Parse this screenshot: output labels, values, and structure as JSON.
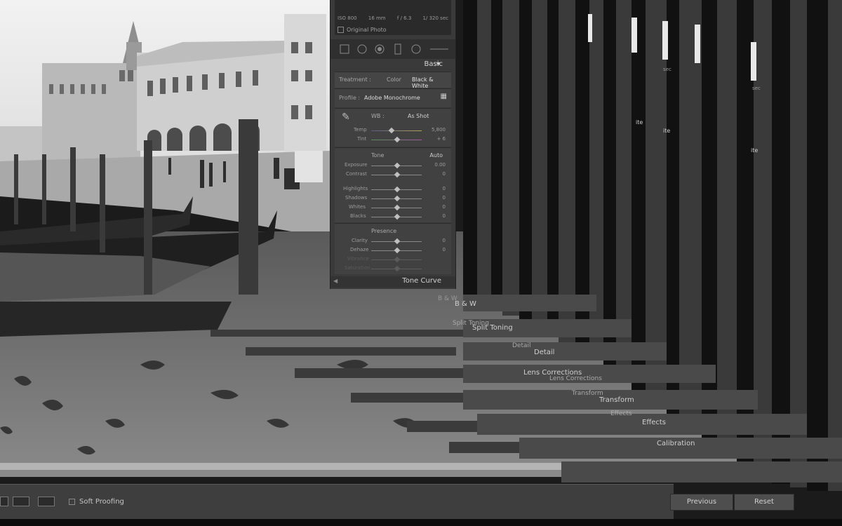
{
  "histogram": {
    "iso": "ISO 800",
    "focal": "16 mm",
    "aperture": "f / 6.3",
    "shutter": "1/ 320 sec",
    "original_photo_label": "Original Photo"
  },
  "basic": {
    "header": "Basic",
    "treatment_label": "Treatment :",
    "treatment_color": "Color",
    "treatment_bw": "Black & White",
    "profile_label": "Profile :",
    "profile_value": "Adobe Monochrome",
    "wb_label": "WB :",
    "wb_value": "As Shot",
    "temp_label": "Temp",
    "temp_value": "5,800",
    "tint_label": "Tint",
    "tint_value": "+ 6",
    "tone_label": "Tone",
    "auto_label": "Auto",
    "exposure_label": "Exposure",
    "exposure_value": "0.00",
    "contrast_label": "Contrast",
    "contrast_value": "0",
    "highlights_label": "Highlights",
    "highlights_value": "0",
    "shadows_label": "Shadows",
    "shadows_value": "0",
    "whites_label": "Whites",
    "whites_value": "0",
    "blacks_label": "Blacks",
    "blacks_value": "0",
    "presence_label": "Presence",
    "clarity_label": "Clarity",
    "clarity_value": "0",
    "dehaze_label": "Dehaze",
    "dehaze_value": "0",
    "vibrance_label": "Vibrance",
    "saturation_label": "Saturation"
  },
  "panels": {
    "tone_curve": "Tone Curve",
    "bw": "B & W",
    "split_toning": "Split Toning",
    "detail": "Detail",
    "lens_corrections": "Lens Corrections",
    "transform": "Transform",
    "effects": "Effects",
    "calibration": "Calibration"
  },
  "ghost_labels": {
    "bw": "B & W",
    "split_toning": "Split Toning",
    "detail": "Detail",
    "lens_corrections": "Lens Corrections",
    "transform": "Transform",
    "effects": "Effects",
    "col_ite": "ite",
    "col_sec": "sec"
  },
  "toolbar": {
    "soft_proofing": "Soft Proofing",
    "previous": "Previous",
    "reset": "Reset"
  }
}
